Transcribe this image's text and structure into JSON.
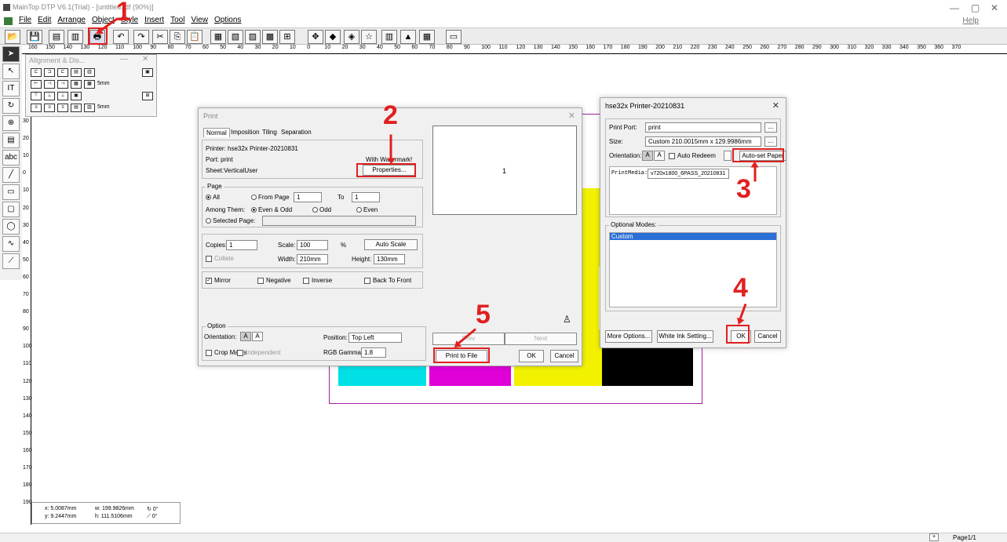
{
  "app": {
    "title": "MainTop DTP V6.1(Trial) - [untitled.tdf (90%)]",
    "help": "Help"
  },
  "menu": [
    "File",
    "Edit",
    "Arrange",
    "Object",
    "Style",
    "Insert",
    "Tool",
    "View",
    "Options"
  ],
  "ruler_h": [
    "160",
    "150",
    "140",
    "130",
    "120",
    "110",
    "100",
    "90",
    "80",
    "70",
    "60",
    "50",
    "40",
    "30",
    "20",
    "10",
    "0",
    "10",
    "20",
    "30",
    "40",
    "50",
    "60",
    "70",
    "80",
    "90",
    "100",
    "110",
    "120",
    "130",
    "140",
    "150",
    "160",
    "170",
    "180",
    "190",
    "200",
    "210",
    "220",
    "230",
    "240",
    "250",
    "260",
    "270",
    "280",
    "290",
    "300",
    "310",
    "320",
    "330",
    "340",
    "350",
    "360",
    "370"
  ],
  "ruler_v": [
    "30",
    "20",
    "10",
    "0",
    "10",
    "20",
    "30",
    "40",
    "50",
    "60",
    "70",
    "80",
    "90",
    "100",
    "110",
    "120",
    "130",
    "140",
    "150",
    "160",
    "170",
    "180",
    "190"
  ],
  "align_palette": {
    "title": "Alignment & Dis...",
    "spacing_1": "5mm",
    "spacing_2": "5mm"
  },
  "print_dialog": {
    "title": "Print",
    "tabs": [
      "Normal",
      "Imposition",
      "Tiling",
      "Separation"
    ],
    "printer": "Printer:  hse32x Printer-20210831",
    "port": "Port:  print",
    "sheet": "Sheet:VerticalUser",
    "watermark": "With Watermark!",
    "properties": "Properties...",
    "page_group": "Page",
    "all": "All",
    "from_page": "From Page",
    "from_val": "1",
    "to": "To",
    "to_val": "1",
    "among": "Among Them:",
    "even_odd": "Even & Odd",
    "odd": "Odd",
    "even": "Even",
    "selected_page": "Selected Page:",
    "copies_label": "Copies:",
    "copies": "1",
    "scale_label": "Scale:",
    "scale": "100",
    "percent": "%",
    "auto_scale": "Auto Scale",
    "collate": "Collate",
    "width_label": "Width:",
    "width": "210mm",
    "height_label": "Height:",
    "height": "130mm",
    "mirror": "Mirror",
    "negative": "Negative",
    "inverse": "Inverse",
    "back_to_front": "Back To Front",
    "option_group": "Option",
    "orientation": "Orientation:",
    "position_label": "Position:",
    "position": "Top Left",
    "crop_marks": "Crop Marks",
    "independent": "Independent",
    "rgb_gamma_label": "RGB Gamma:",
    "rgb_gamma": "1.8",
    "preview_page": "1",
    "prev": "Prev",
    "next": "Next",
    "print_to_file": "Print to File",
    "ok": "OK",
    "cancel": "Cancel"
  },
  "printer_dialog": {
    "title": "hse32x Printer-20210831",
    "print_port_label": "Print Port:",
    "print_port": "print",
    "size_label": "Size:",
    "size": "Custom 210.0015mm x 129.9986mm",
    "orientation": "Orientation:",
    "auto_redeem": "Auto Redeem",
    "auto_set_paper": "Auto-set Paper",
    "print_media_label": "PrintMedia:",
    "print_media": "v720x1800_6PASS_20210831",
    "optional_modes": "Optional Modes:",
    "mode_selected": "Custom",
    "more_options": "More Options...",
    "white_ink": "White Ink Setting...",
    "ok": "OK",
    "cancel": "Cancel"
  },
  "status": {
    "x": "x: 5.0087mm",
    "y": "y: 9.2447mm",
    "w": "w: 199.9826mm",
    "h": "h: 111.5106mm",
    "rot": "0°",
    "skew": "0°"
  },
  "footer": {
    "page": "Page1/1"
  },
  "annotations": [
    "1",
    "2",
    "3",
    "4",
    "5"
  ],
  "colors": {
    "cyan": "#00e0e6",
    "magenta": "#e000d8",
    "yellow": "#f2f200",
    "black": "#000000",
    "highlight": "#e02020",
    "select": "#2a6fd6"
  }
}
